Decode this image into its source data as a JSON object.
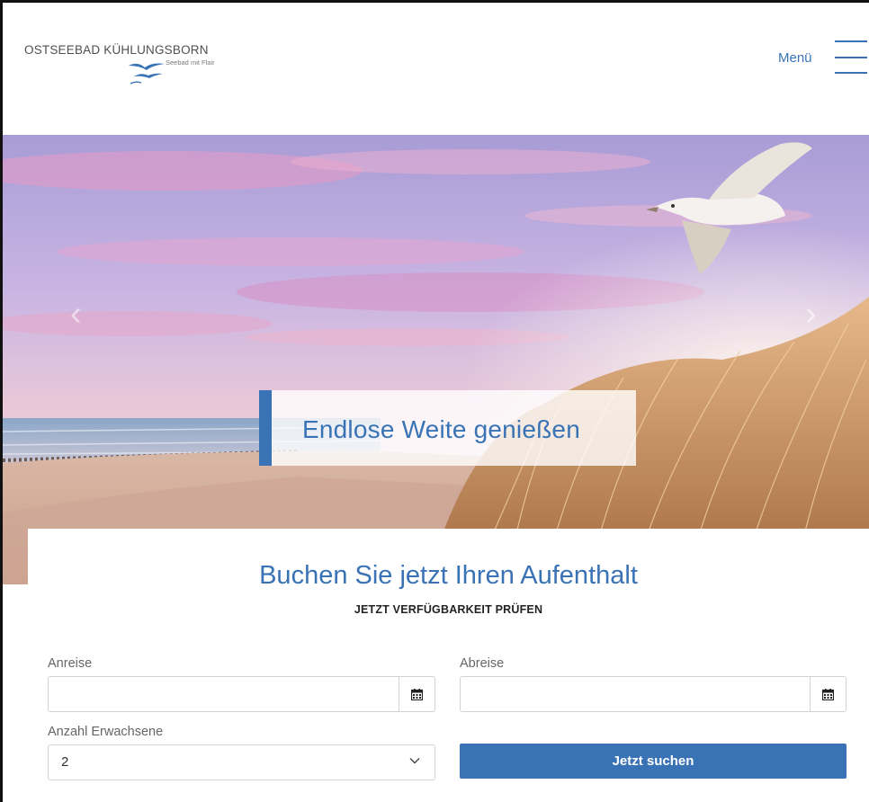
{
  "header": {
    "logo_title": "OSTSEEBAD KÜHLUNGSBORN",
    "logo_subtitle": "Seebad mit Flair",
    "menu_label": "Menü"
  },
  "hero": {
    "caption": "Endlose Weite genießen",
    "prev_glyph": "‹",
    "next_glyph": "›"
  },
  "booking": {
    "title": "Buchen Sie jetzt Ihren Aufenthalt",
    "subtitle": "JETZT VERFÜGBARKEIT PRÜFEN",
    "arrival_label": "Anreise",
    "arrival_value": "",
    "departure_label": "Abreise",
    "departure_value": "",
    "adults_label": "Anzahl Erwachsene",
    "adults_value": "2",
    "search_label": "Jetzt suchen"
  },
  "colors": {
    "accent": "#3a73b5",
    "text": "#222222"
  },
  "icons": [
    "seagull-logo-icon",
    "hamburger-menu-icon",
    "calendar-icon",
    "chevron-down-icon",
    "chevron-left-icon",
    "chevron-right-icon"
  ]
}
